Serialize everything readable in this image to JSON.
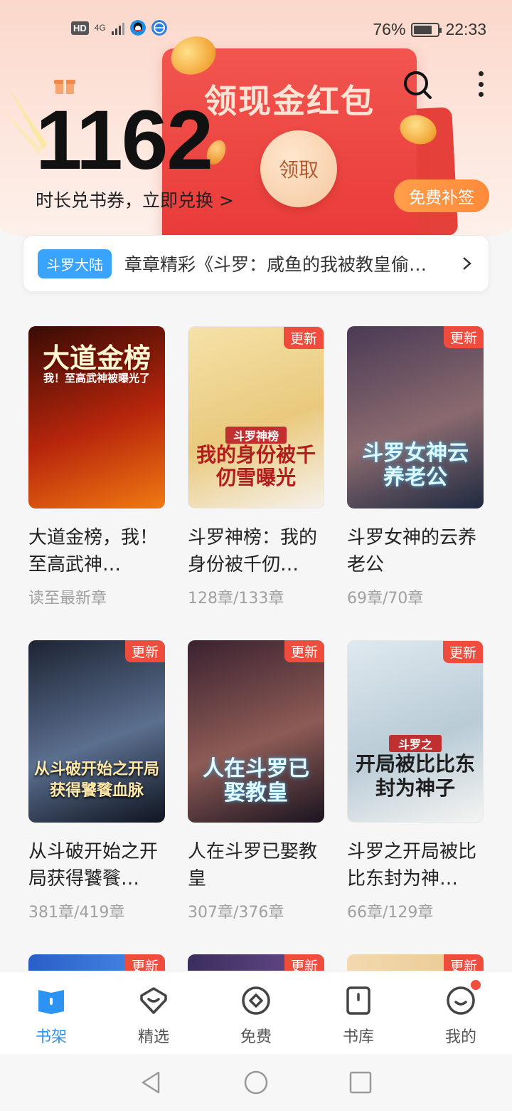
{
  "status_bar": {
    "hd": "HD",
    "network": "4G",
    "battery_text": "76%",
    "battery_level": 0.76,
    "time": "22:33"
  },
  "header": {
    "coupon_count": "1162",
    "exchange_text": "时长兑书券，立即兑换 >",
    "banner_title": "领现金红包",
    "claim_label": "领取",
    "sign_label": "免费补签"
  },
  "notice": {
    "tag": "斗罗大陆",
    "text": "章章精彩《斗罗：咸鱼的我被教皇偷…"
  },
  "books": [
    {
      "title": "大道金榜，我！至高武神…",
      "progress": "读至最新章",
      "badge": "",
      "cover_title": "大道金榜",
      "cover_sub": "我！至高武神被曝光了",
      "colors": [
        "#3a0b05",
        "#b8260c",
        "#f07a12"
      ]
    },
    {
      "title": "斗罗神榜：我的身份被千仞…",
      "progress": "128章/133章",
      "badge": "更新",
      "cover_title": "我的身份被千仞雪曝光",
      "cover_sub": "斗罗神榜",
      "colors": [
        "#f5e2a8",
        "#e9c97d",
        "#f5f1ea"
      ]
    },
    {
      "title": "斗罗女神的云养老公",
      "progress": "69章/70章",
      "badge": "更新",
      "cover_title": "斗罗女神云养老公",
      "cover_sub": "",
      "colors": [
        "#4a3a55",
        "#8a6a6f",
        "#1f2a40"
      ]
    },
    {
      "title": "从斗破开始之开局获得饕餮…",
      "progress": "381章/419章",
      "badge": "更新",
      "cover_title": "从斗破开始之开局获得饕餮血脉",
      "cover_sub": "",
      "colors": [
        "#1d2433",
        "#5b6f8f",
        "#0f1420"
      ]
    },
    {
      "title": "人在斗罗已娶教皇",
      "progress": "307章/376章",
      "badge": "更新",
      "cover_title": "人在斗罗已娶教皇",
      "cover_sub": "",
      "colors": [
        "#3a2230",
        "#8d5b55",
        "#1a1420"
      ]
    },
    {
      "title": "斗罗之开局被比比东封为神…",
      "progress": "66章/129章",
      "badge": "更新",
      "cover_title": "开局被比比东封为神子",
      "cover_sub": "斗罗之",
      "colors": [
        "#dfe9ef",
        "#b9cbd6",
        "#f4f4f2"
      ]
    }
  ],
  "partial_badges": [
    "更新",
    "更新",
    "更新"
  ],
  "bottom_nav": [
    {
      "label": "书架",
      "icon": "bookshelf-icon",
      "active": true
    },
    {
      "label": "精选",
      "icon": "featured-icon",
      "active": false
    },
    {
      "label": "免费",
      "icon": "free-icon",
      "active": false
    },
    {
      "label": "书库",
      "icon": "library-icon",
      "active": false
    },
    {
      "label": "我的",
      "icon": "profile-icon",
      "active": false
    }
  ],
  "colors": {
    "accent": "#2c93f3",
    "badge": "#f04c3d",
    "tag": "#38a4ff",
    "sign": "#ff8a3a"
  }
}
